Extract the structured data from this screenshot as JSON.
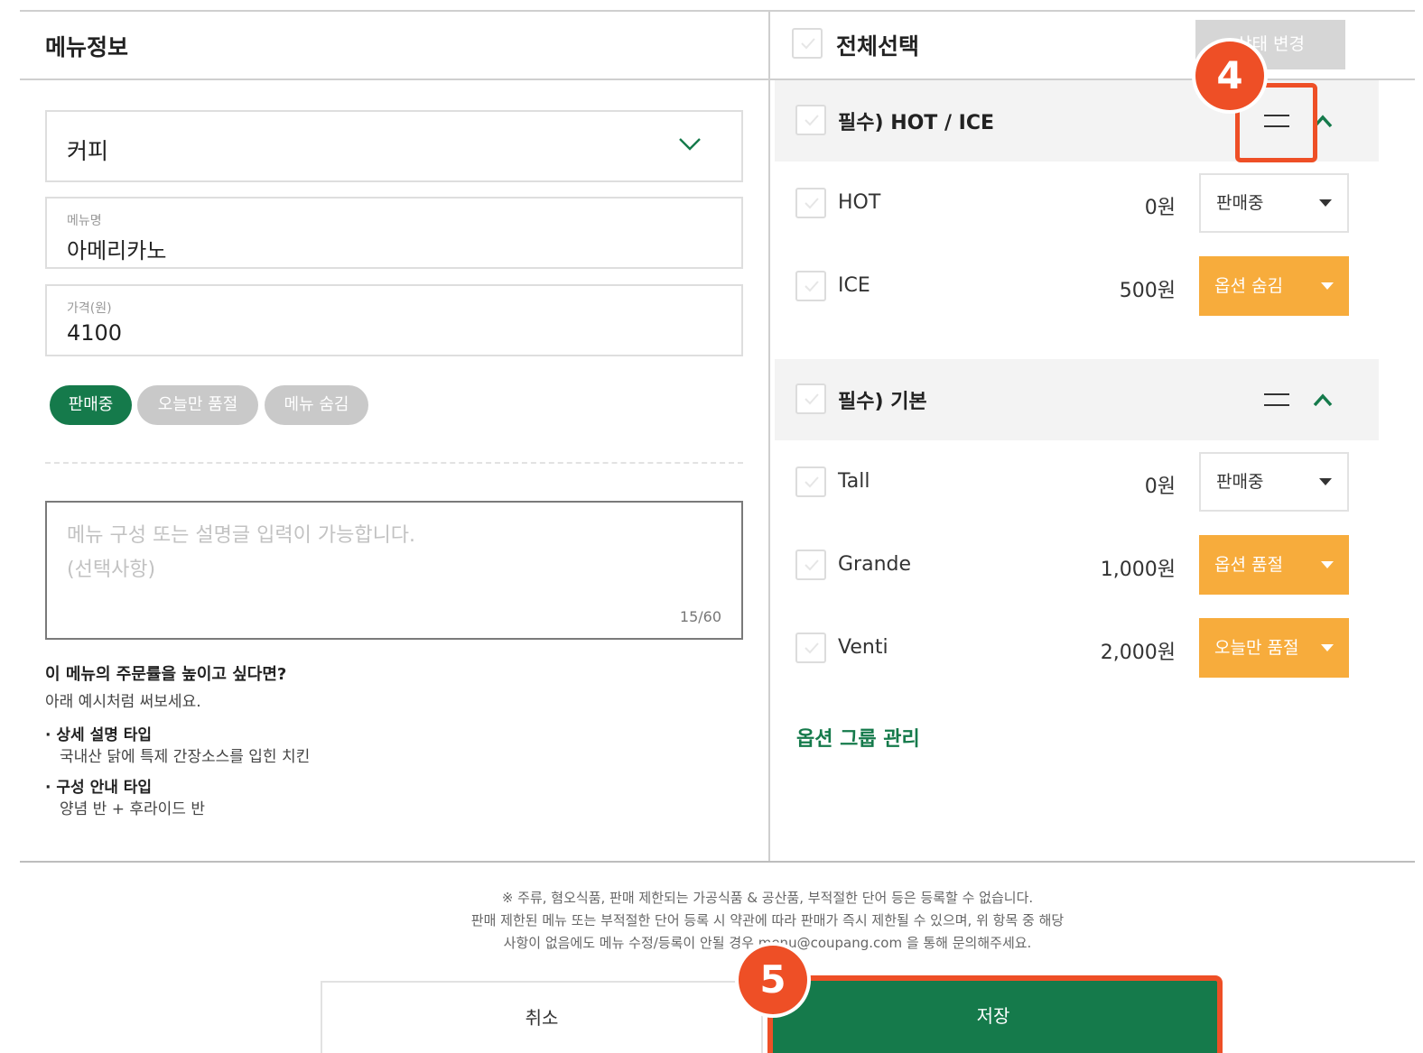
{
  "left": {
    "title": "메뉴정보",
    "category": "커피",
    "name_label": "메뉴명",
    "name_value": "아메리카노",
    "price_label": "가격(원)",
    "price_value": "4100",
    "status_pills": [
      "판매중",
      "오늘만 품절",
      "메뉴 숨김"
    ],
    "desc_placeholder_1": "메뉴 구성 또는 설명글 입력이 가능합니다.",
    "desc_placeholder_2": "(선택사항)",
    "desc_counter": "15/60",
    "tip_heading": "이 메뉴의 주문률을 높이고 싶다면?",
    "tip_sub": "아래 예시처럼 써보세요.",
    "tip_b1": "· 상세 설명 타입",
    "tip_t1": "국내산 닭에 특제 간장소스를 입힌 치킨",
    "tip_b2": "· 구성 안내 타입",
    "tip_t2": "양념 반 + 후라이드 반"
  },
  "right": {
    "select_all": "전체선택",
    "state_button": "상태 변경",
    "groups": [
      {
        "label": "필수) HOT / ICE",
        "options": [
          {
            "name": "HOT",
            "price": "0원",
            "status": "판매중"
          },
          {
            "name": "ICE",
            "price": "500원",
            "status": "옵션 숨김"
          }
        ]
      },
      {
        "label": "필수) 기본",
        "options": [
          {
            "name": "Tall",
            "price": "0원",
            "status": "판매중"
          },
          {
            "name": "Grande",
            "price": "1,000원",
            "status": "옵션 품절"
          },
          {
            "name": "Venti",
            "price": "2,000원",
            "status": "오늘만 품절"
          }
        ]
      }
    ],
    "manage_link": "옵션 그룹 관리"
  },
  "notice": {
    "line1": "※ 주류, 혐오식품, 판매 제한되는 가공식품 & 공산품, 부적절한 단어 등은 등록할 수 없습니다.",
    "line2": "판매 제한된 메뉴 또는 부적절한 단어 등록 시 약관에 따라 판매가 즉시 제한될 수 있으며, 위 항목 중 해당",
    "line3": "사항이 없음에도 메뉴 수정/등록이 안될 경우 menu@coupang.com 을 통해 문의해주세요."
  },
  "actions": {
    "cancel": "취소",
    "save": "저장"
  },
  "annotations": {
    "step4": "4",
    "step5": "5"
  },
  "colors": {
    "brand_green": "#157a4b",
    "orange_status": "#f7ac3c",
    "highlight": "#ee4f26"
  }
}
